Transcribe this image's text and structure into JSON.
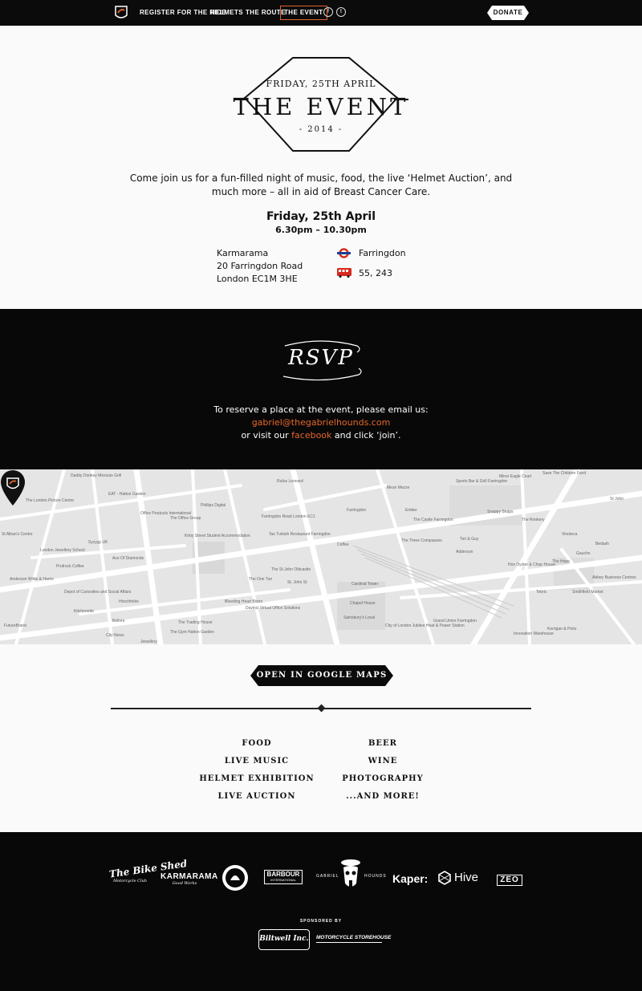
{
  "nav": {
    "links": [
      "REGISTER FOR THE RIDE",
      "HELMETS",
      "THE ROUTE",
      "THE EVENT"
    ],
    "social": [
      "f",
      "t"
    ],
    "donate": "DONATE",
    "accent": "#e0642b"
  },
  "hero": {
    "emblem": {
      "date": "FRIDAY, 25TH APRIL",
      "title": "THE EVENT",
      "year": "- 2014 -"
    },
    "intro": "Come join us for a fun-filled night of music, food, the live ‘Helmet Auction’, and much more – all in aid of Breast Cancer Care.",
    "date": "Friday, 25th April",
    "time": "6.30pm – 10.30pm",
    "address": [
      "Karmarama",
      "20 Farringdon Road",
      "London EC1M 3HE"
    ],
    "transport": [
      {
        "icon": "underground-roundel-icon",
        "text": "Farringdon"
      },
      {
        "icon": "bus-icon",
        "text": "55, 243"
      }
    ]
  },
  "rsvp": {
    "title": "RSVP",
    "line1": "To reserve a place at the event, please email us:",
    "email": "gabriel@thegabrielhounds.com",
    "line3_pre": "or visit our ",
    "line3_link": "facebook",
    "line3_post": " and click ‘join’.",
    "accent": "#e8672c"
  },
  "map": {
    "labels": [
      "Daddy Donkey Mexican Grill",
      "EAT - Hatton Garden",
      "Phillips Digital",
      "Rufus Leonard",
      "Meze Mezze",
      "Sports Bar & Grill Farringdon",
      "Minor Eagle Court",
      "Save The Children Fund",
      "St John",
      "The London Picture Centre",
      "Office Products International",
      "The Office Group",
      "Kirby Street Student Accommodation",
      "Farringdon Road London EC1",
      "Farringdon",
      "Ember",
      "The Castle Farringdon",
      "Snappy Snaps",
      "The Rookery",
      "Vinoteca",
      "Bedash",
      "St Alban's Centre",
      "London Jewellery School",
      "Syzygy UK",
      "Ace Of Diamonds",
      "Tas Turkish Restaurant Farringdon",
      "The Three Compasses",
      "Tori & Guy",
      "Coffee",
      "Adderson",
      "Gaucho",
      "Hox Oyster & Chop House",
      "The Hope",
      "Smithfield Market",
      "Abbey Business Centres",
      "Prufrock Coffee",
      "Anderson Wilde & Harris",
      "The One Tun",
      "The St John Oldcastle",
      "Cardinal Tower",
      "St. John St",
      "Depot of Curiosities and Social Affairs",
      "Bleeding Heart Bistro",
      "Davinci Virtual Office Solutions",
      "Chapel House",
      "Tebric",
      "Sainsbury's Local",
      "City of London Jubilee Heat & Power Station",
      "Grand Union Farringdon",
      "Kerrigan & Pinto",
      "Innovation Warehouse",
      "Kitchenette",
      "Bellore",
      "FutureBrand",
      "City News",
      "Jewellery",
      "The Trading House",
      "The Gym Hatton Garden",
      "Hirschfelds"
    ]
  },
  "map_button": "OPEN IN GOOGLE MAPS",
  "features": {
    "left": [
      "FOOD",
      "LIVE MUSIC",
      "HELMET EXHIBITION",
      "LIVE AUCTION"
    ],
    "right": [
      "BEER",
      "WINE",
      "PHOTOGRAPHY",
      "...AND MORE!"
    ]
  },
  "footer": {
    "logos": [
      "The Bike Shed",
      "Motorcycle Club",
      "KARMARAMA",
      "Good Works",
      "BARBOUR",
      "INTERNATIONAL",
      "GABRIEL",
      "HOUNDS",
      "Kaper:",
      "Hive",
      "ZEO"
    ],
    "sponsored": "SPONSORED BY",
    "sponsors": [
      "Biltwell Inc.",
      "MOTORCYCLE STOREHOUSE"
    ]
  }
}
